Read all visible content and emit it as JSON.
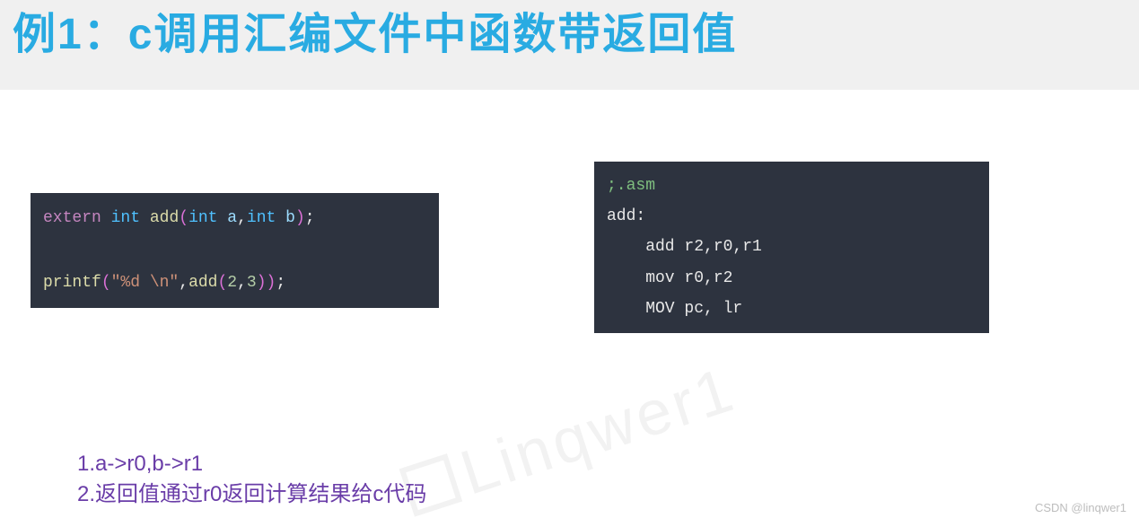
{
  "header": {
    "title": "例1：c调用汇编文件中函数带返回值"
  },
  "code_left": {
    "tokens": [
      {
        "cls": "kw-extern",
        "t": "extern"
      },
      {
        "cls": "txt",
        "t": " "
      },
      {
        "cls": "kw-type",
        "t": "int"
      },
      {
        "cls": "txt",
        "t": " "
      },
      {
        "cls": "fn",
        "t": "add"
      },
      {
        "cls": "paren",
        "t": "("
      },
      {
        "cls": "kw-type",
        "t": "int"
      },
      {
        "cls": "txt",
        "t": " "
      },
      {
        "cls": "param",
        "t": "a"
      },
      {
        "cls": "txt",
        "t": ","
      },
      {
        "cls": "kw-type",
        "t": "int"
      },
      {
        "cls": "txt",
        "t": " "
      },
      {
        "cls": "param",
        "t": "b"
      },
      {
        "cls": "paren",
        "t": ")"
      },
      {
        "cls": "txt",
        "t": ";"
      },
      {
        "cls": "",
        "t": "\n\n"
      },
      {
        "cls": "fn",
        "t": "printf"
      },
      {
        "cls": "paren",
        "t": "("
      },
      {
        "cls": "str",
        "t": "\"%d \\n\""
      },
      {
        "cls": "txt",
        "t": ","
      },
      {
        "cls": "fn",
        "t": "add"
      },
      {
        "cls": "paren",
        "t": "("
      },
      {
        "cls": "num",
        "t": "2"
      },
      {
        "cls": "txt",
        "t": ","
      },
      {
        "cls": "num",
        "t": "3"
      },
      {
        "cls": "paren",
        "t": ")"
      },
      {
        "cls": "paren",
        "t": ")"
      },
      {
        "cls": "txt",
        "t": ";"
      }
    ]
  },
  "code_right": {
    "lines": [
      {
        "cls": "cmt",
        "t": ";.asm"
      },
      {
        "cls": "txt",
        "t": "add:"
      },
      {
        "cls": "txt",
        "t": "    add r2,r0,r1"
      },
      {
        "cls": "txt",
        "t": "    mov r0,r2"
      },
      {
        "cls": "txt",
        "t": "    MOV pc, lr"
      }
    ]
  },
  "notes": {
    "line1": "1.a->r0,b->r1",
    "line2": "2.返回值通过r0返回计算结果给c代码"
  },
  "watermark": {
    "text": "Linqwer1"
  },
  "footer": {
    "text": "CSDN @linqwer1"
  }
}
